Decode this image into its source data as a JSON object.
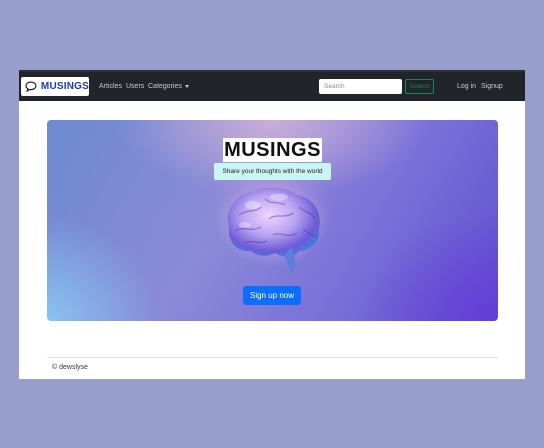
{
  "navbar": {
    "brand": "MUSINGS",
    "links": {
      "articles": "Articles",
      "users": "Users",
      "categories": "Categories"
    },
    "search": {
      "placeholder": "Search",
      "button": "Search"
    },
    "auth": {
      "login": "Log in",
      "signup": "Signup"
    }
  },
  "hero": {
    "title": "MUSINGS",
    "subtitle": "Share your thoughts with the world",
    "cta": "Sign up now"
  },
  "footer": {
    "text": "© dewslyse"
  },
  "colors": {
    "navbar": "#212529",
    "brand_text": "#1f35b8",
    "primary": "#0d6efd",
    "success": "#198754",
    "subtitle_bg": "#c9f5f2",
    "page_bg": "#989fcc"
  },
  "icons": {
    "brand": "speech-bubble-icon",
    "dropdown": "caret-down-icon"
  }
}
